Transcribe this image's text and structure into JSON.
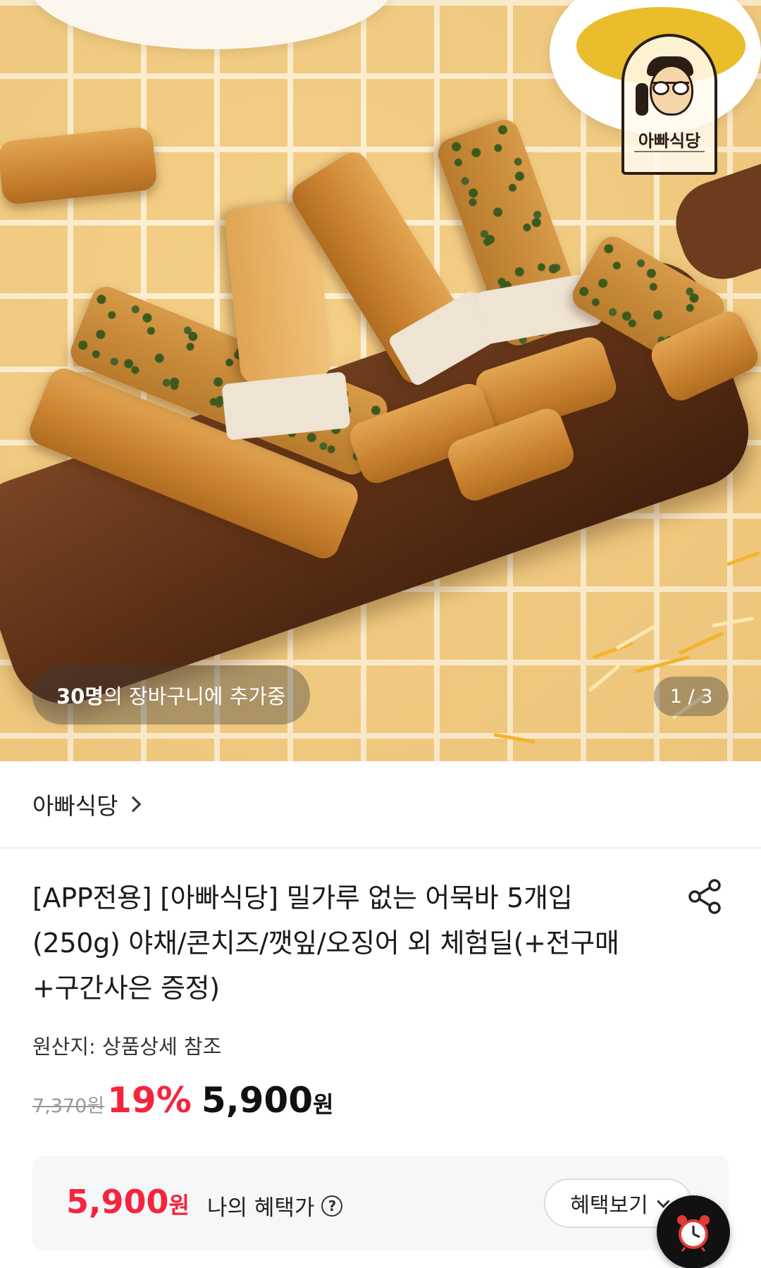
{
  "hero": {
    "logo_text": "아빠식당",
    "cart_count": "30명",
    "cart_text": "의 장바구니에 추가중",
    "page_indicator": "1 / 3"
  },
  "seller": {
    "name": "아빠식당"
  },
  "product": {
    "title": "[APP전용] [아빠식당] 밀가루 없는 어묵바 5개입(250g) 야채/콘치즈/깻잎/오징어 외 체험딜(+전구매+구간사은 증정)",
    "origin": "원산지: 상품상세 참조",
    "original_price": "7,370원",
    "discount": "19%",
    "sale_price": "5,900",
    "sale_unit": "원"
  },
  "benefit": {
    "price": "5,900",
    "unit": "원",
    "label": "나의 혜택가",
    "help_glyph": "?",
    "button_label": "혜택보기"
  },
  "icons": {
    "share": "share-icon",
    "alarm": "alarm-clock-icon",
    "chevron": "chevron-right-icon"
  },
  "colors": {
    "accent_red": "#f5243c",
    "text_dark": "#111111",
    "muted": "#999999",
    "box_bg": "#f6f7f9"
  }
}
